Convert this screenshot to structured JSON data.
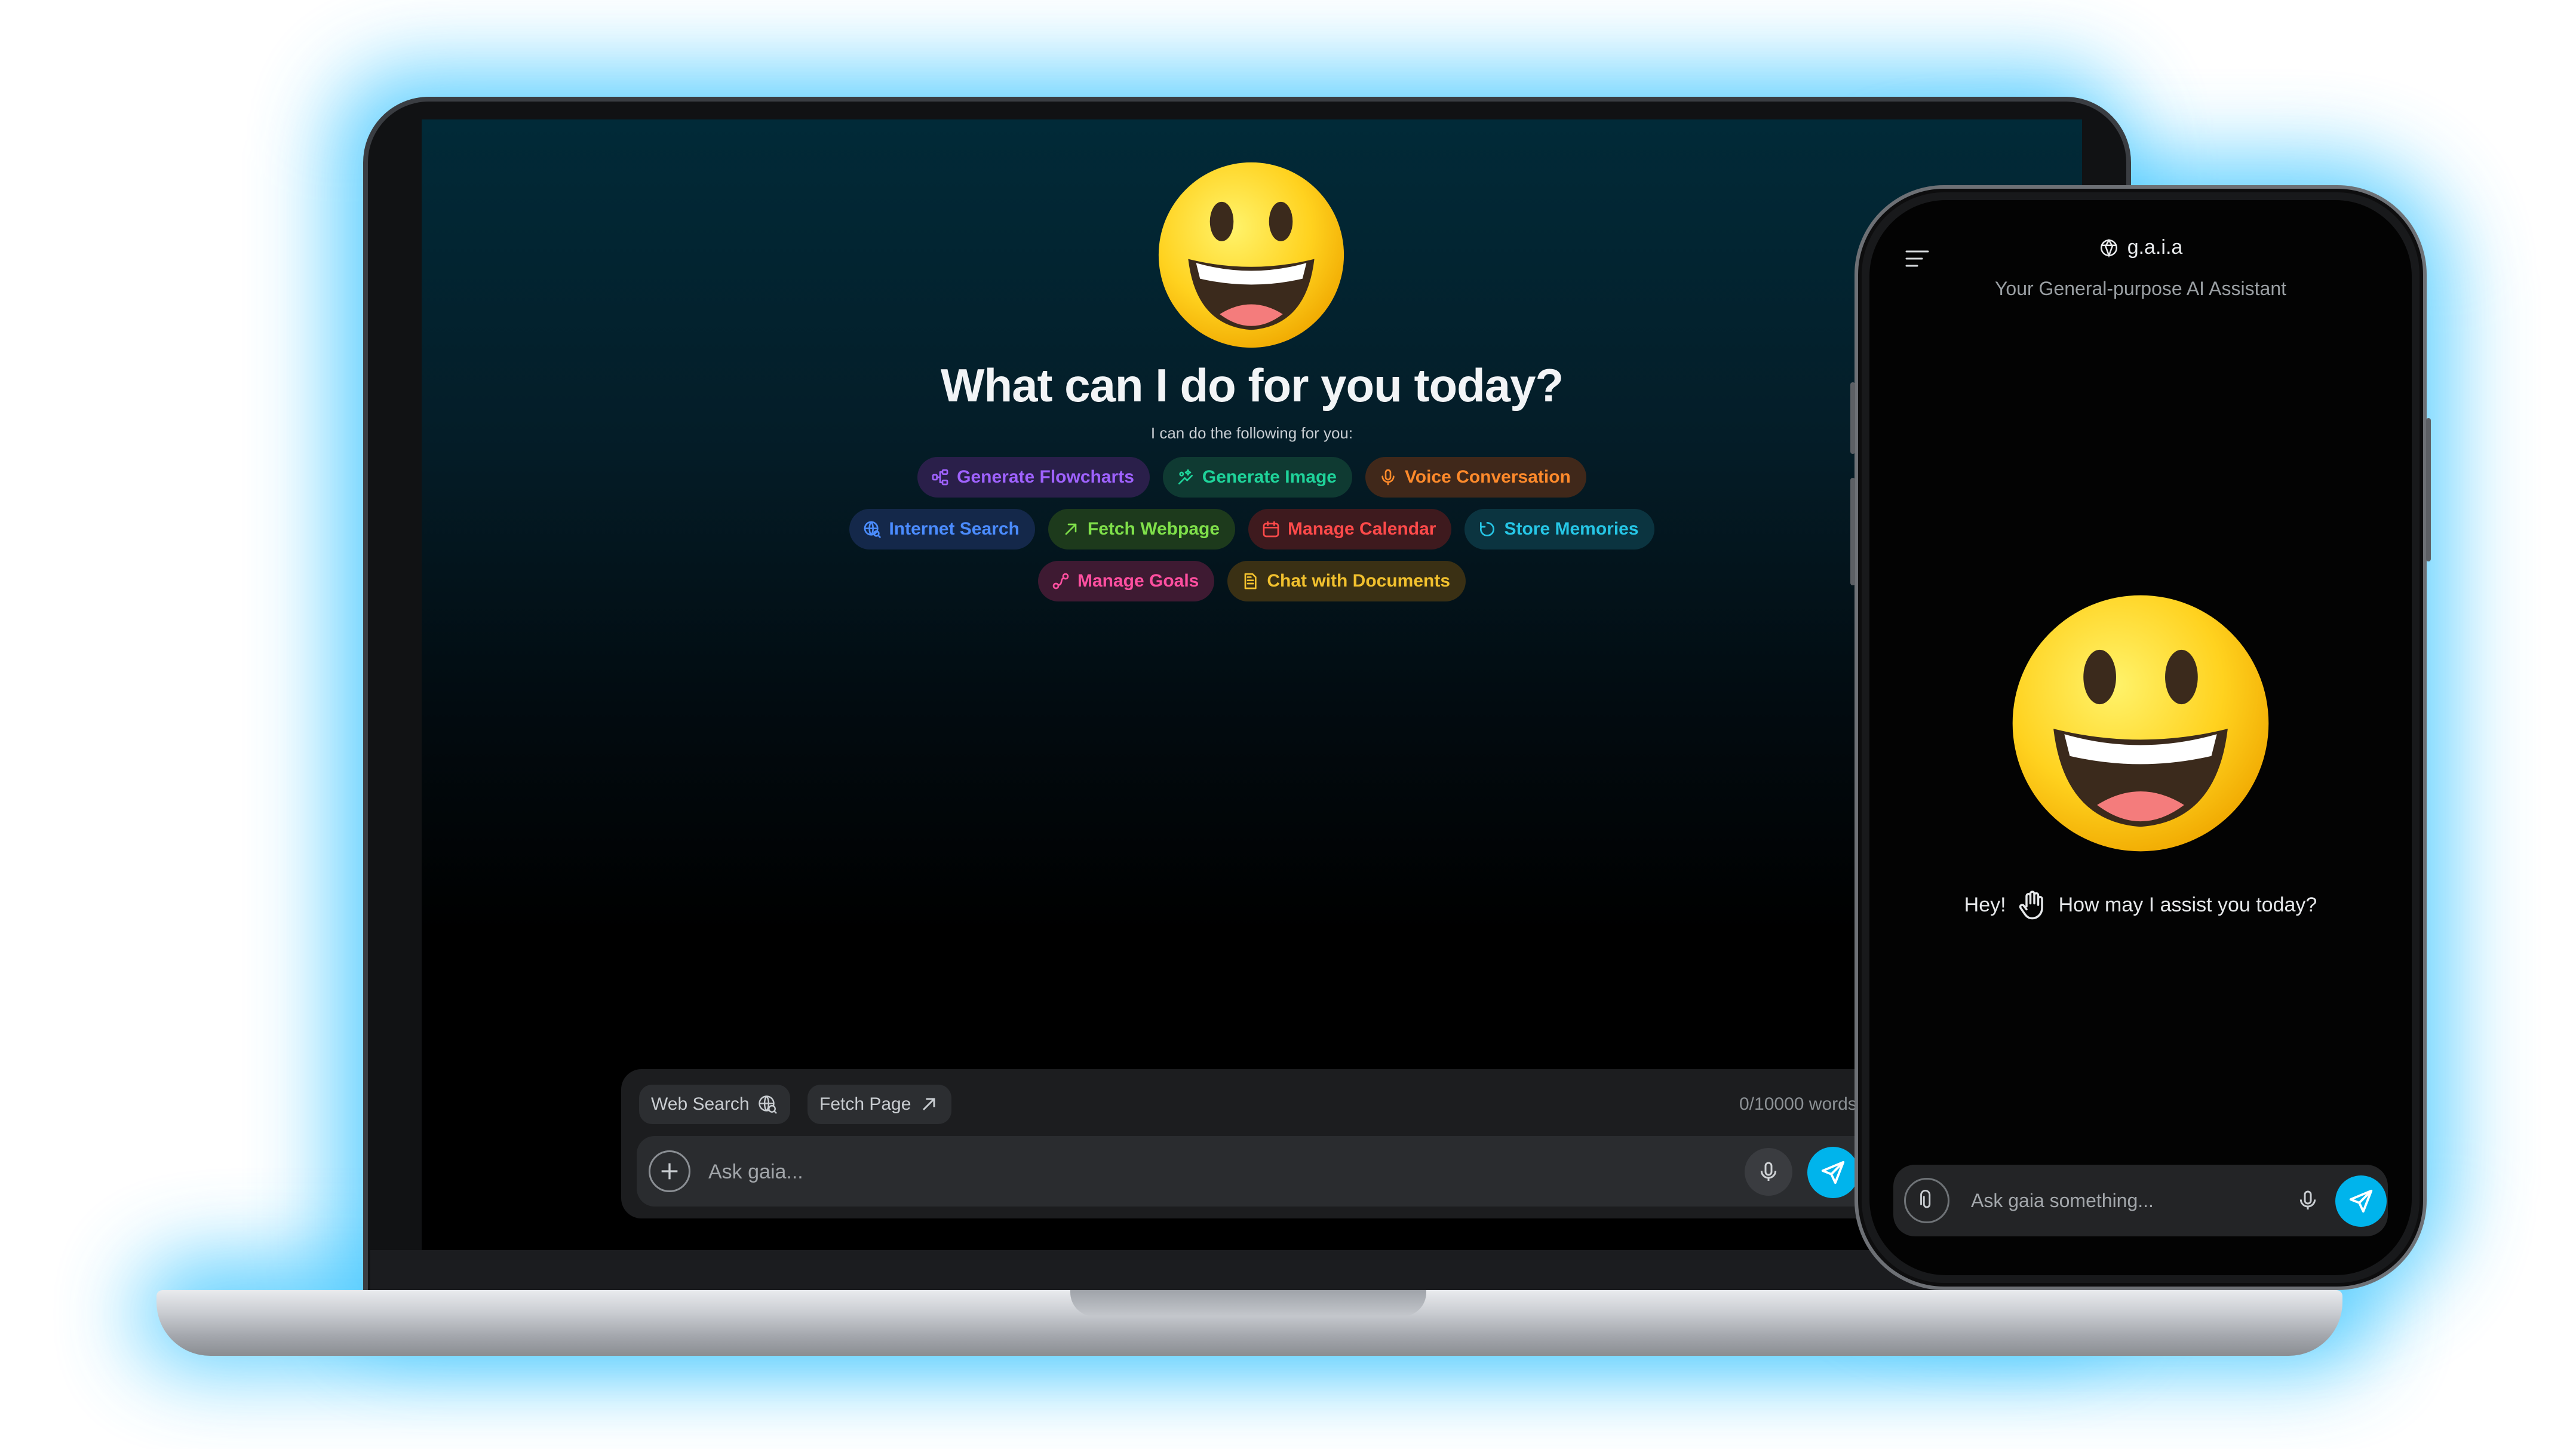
{
  "colors": {
    "glow": "#3fc6ff",
    "accent_send": "#00b4ec",
    "screen_top": "#012a38",
    "screen_bottom": "#000000"
  },
  "desktop": {
    "heading": "What can I do for you today?",
    "subheading": "I can do the following for you:",
    "capabilities": [
      {
        "label": "Generate Flowcharts",
        "icon": "flowchart-icon",
        "color": "#9f62ff",
        "bg": "#2a1f4a"
      },
      {
        "label": "Generate Image",
        "icon": "image-sparkle-icon",
        "color": "#1fd39a",
        "bg": "#0f3a32"
      },
      {
        "label": "Voice Conversation",
        "icon": "microphone-icon",
        "color": "#ff8a2b",
        "bg": "#40281a"
      },
      {
        "label": "Internet Search",
        "icon": "globe-search-icon",
        "color": "#4b8cff",
        "bg": "#14284a"
      },
      {
        "label": "Fetch Webpage",
        "icon": "arrow-up-right-icon",
        "color": "#7fe04a",
        "bg": "#1d3a1c"
      },
      {
        "label": "Manage Calendar",
        "icon": "calendar-icon",
        "color": "#ff4a4a",
        "bg": "#3e1a1e"
      },
      {
        "label": "Store Memories",
        "icon": "memory-icon",
        "color": "#26c6e6",
        "bg": "#0b3440"
      },
      {
        "label": "Manage Goals",
        "icon": "goal-icon",
        "color": "#ff4fa0",
        "bg": "#3e1a32"
      },
      {
        "label": "Chat with Documents",
        "icon": "document-icon",
        "color": "#f2c12e",
        "bg": "#3a3014"
      }
    ],
    "composer": {
      "web_search_label": "Web Search",
      "fetch_page_label": "Fetch Page",
      "word_count": "0/10000 words",
      "placeholder": "Ask gaia..."
    }
  },
  "mobile": {
    "brand": "g.a.i.a",
    "tagline": "Your General-purpose AI Assistant",
    "greeting_hey": "Hey!",
    "greeting_rest": "How may I assist you today?",
    "placeholder": "Ask gaia something..."
  }
}
